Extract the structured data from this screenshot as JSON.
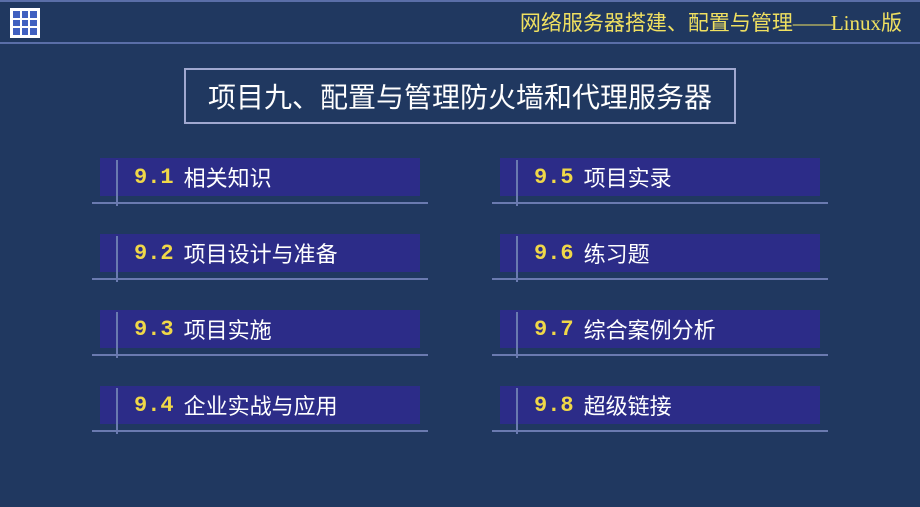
{
  "header": {
    "title_prefix": "网络服务器搭建、配置与管理",
    "title_dash": "——",
    "title_suffix": "Linux版"
  },
  "title": "项目九、配置与管理防火墙和代理服务器",
  "left_items": [
    {
      "num": "9.1",
      "label": "相关知识"
    },
    {
      "num": "9.2",
      "label": "项目设计与准备"
    },
    {
      "num": "9.3",
      "label": "项目实施"
    },
    {
      "num": "9.4",
      "label": "企业实战与应用"
    }
  ],
  "right_items": [
    {
      "num": "9.5",
      "label": "项目实录"
    },
    {
      "num": "9.6",
      "label": "练习题"
    },
    {
      "num": "9.7",
      "label": "综合案例分析"
    },
    {
      "num": "9.8",
      "label": "超级链接"
    }
  ]
}
